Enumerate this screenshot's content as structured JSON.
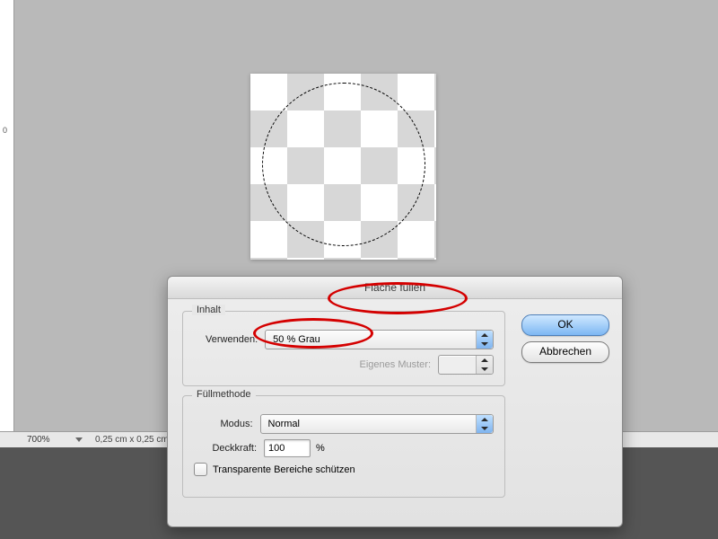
{
  "ruler": {
    "tick0": "0"
  },
  "status": {
    "zoom": "700%",
    "dimensions": "0,25 cm x 0,25 cm"
  },
  "dialog": {
    "title": "Fläche füllen",
    "ok": "OK",
    "cancel": "Abbrechen",
    "content_group": "Inhalt",
    "use_label": "Verwenden:",
    "use_value": "50 % Grau",
    "pattern_label": "Eigenes Muster:",
    "blend_group": "Füllmethode",
    "mode_label": "Modus:",
    "mode_value": "Normal",
    "opacity_label": "Deckkraft:",
    "opacity_value": "100",
    "opacity_unit": "%",
    "preserve_label": "Transparente Bereiche schützen"
  }
}
